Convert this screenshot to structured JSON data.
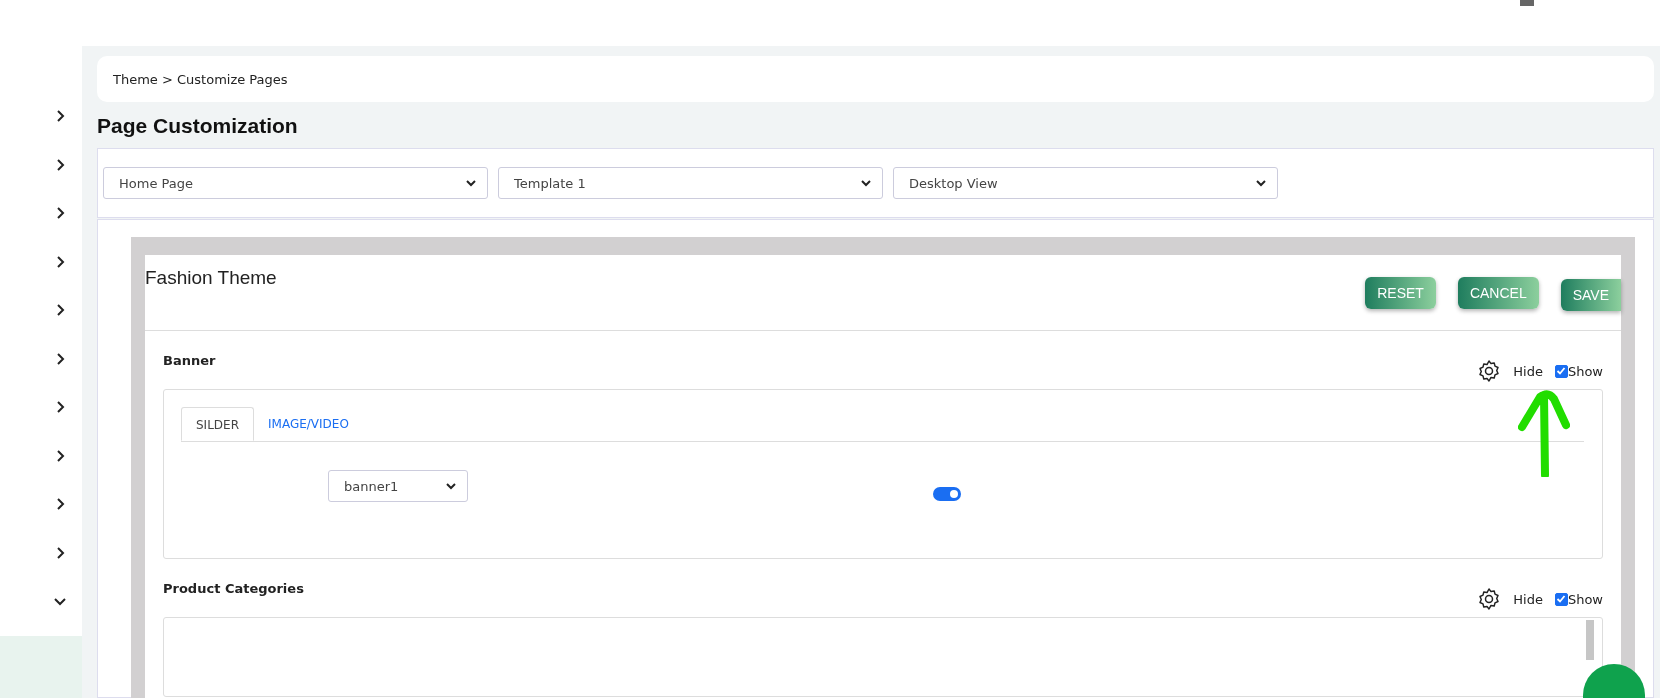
{
  "sidebar": {
    "items": [
      {
        "expanded": false
      },
      {
        "expanded": false
      },
      {
        "expanded": false
      },
      {
        "expanded": false
      },
      {
        "expanded": false
      },
      {
        "expanded": false
      },
      {
        "expanded": false
      },
      {
        "expanded": false
      },
      {
        "expanded": false
      },
      {
        "expanded": false
      },
      {
        "expanded": true
      }
    ]
  },
  "breadcrumb": {
    "items": [
      "Theme",
      "Customize Pages"
    ],
    "separator": ">"
  },
  "title": "Page Customization",
  "selects": [
    {
      "value": "Home Page"
    },
    {
      "value": "Template 1"
    },
    {
      "value": "Desktop View"
    }
  ],
  "preview": {
    "title": "Fashion Theme",
    "buttons": [
      "RESET",
      "CANCEL",
      "SAVE"
    ],
    "sections": [
      {
        "kind": "tabs",
        "title": "Banner",
        "hide_label": "Hide",
        "show_label": "Show",
        "show_checked": true,
        "tabs": [
          {
            "label": "SILDER",
            "selected": true
          },
          {
            "label": "IMAGE/VIDEO",
            "selected": false
          }
        ],
        "select": {
          "value": "banner1"
        },
        "toggle": {
          "on": true
        }
      },
      {
        "kind": "empty",
        "title": "Product Categories",
        "hide_label": "Hide",
        "show_label": "Show",
        "show_checked": true
      }
    ]
  }
}
